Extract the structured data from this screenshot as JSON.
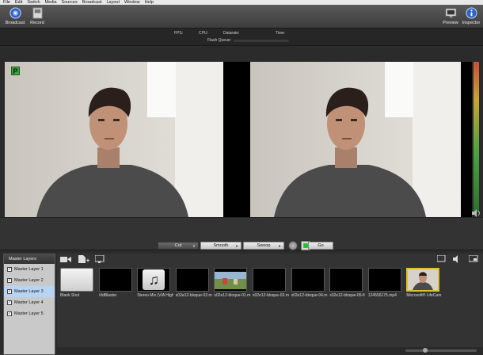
{
  "menu": [
    "File",
    "Edit",
    "Switch",
    "Media",
    "Sources",
    "Broadcast",
    "Layout",
    "Window",
    "Help"
  ],
  "toolbar": {
    "broadcast_label": "Broadcast",
    "record_label": "Record",
    "preview_label": "Preview",
    "inspector_label": "Inspector"
  },
  "stats": {
    "fps_label": "FPS:",
    "cpu_label": "CPU:",
    "datarate_label": "Datarate:",
    "time_label": "Time:",
    "flash_queue_label": "Flash Queue:"
  },
  "preview": {
    "badge": "P"
  },
  "transitions": {
    "cut_label": "Cut",
    "smooth_label": "Smooth",
    "swoop_label": "Swoop",
    "go_label": "Go"
  },
  "layers": {
    "header": "Master Layers",
    "items": [
      {
        "label": "Master Layer 1",
        "checked": true,
        "selected": false
      },
      {
        "label": "Master Layer 2",
        "checked": true,
        "selected": false
      },
      {
        "label": "Master Layer 3",
        "checked": true,
        "selected": true
      },
      {
        "label": "Master Layer 4",
        "checked": true,
        "selected": false
      },
      {
        "label": "Master Layer 5",
        "checked": true,
        "selected": false
      }
    ]
  },
  "shots": [
    {
      "label": "Blank Shot",
      "kind": "blank"
    },
    {
      "label": "VidBlaster",
      "kind": "black"
    },
    {
      "label": "Stereo Mix (VIA High",
      "kind": "audio"
    },
    {
      "label": "s02e12-bloque-02.m",
      "kind": "black"
    },
    {
      "label": "s02e12-bloque-01.m",
      "kind": "scene"
    },
    {
      "label": "s02e12-bloque-03.m",
      "kind": "black"
    },
    {
      "label": "s02e12-bloque-04.m",
      "kind": "black"
    },
    {
      "label": "s02e12-bloque-05-fi",
      "kind": "black"
    },
    {
      "label": "124556175.mp4",
      "kind": "black"
    },
    {
      "label": "Microsoft® LifeCam",
      "kind": "live"
    }
  ],
  "colors": {
    "preview_badge": "#3ea33e",
    "live_border": "#e0c022",
    "go_green": "#29c229",
    "selected_layer": "#b8d4f4"
  },
  "icons": {
    "broadcast": "broadcast-icon",
    "record": "record-icon",
    "preview": "monitor-icon",
    "inspector": "info-icon",
    "speaker": "speaker-icon",
    "audio_shot": "music-note-icon"
  }
}
